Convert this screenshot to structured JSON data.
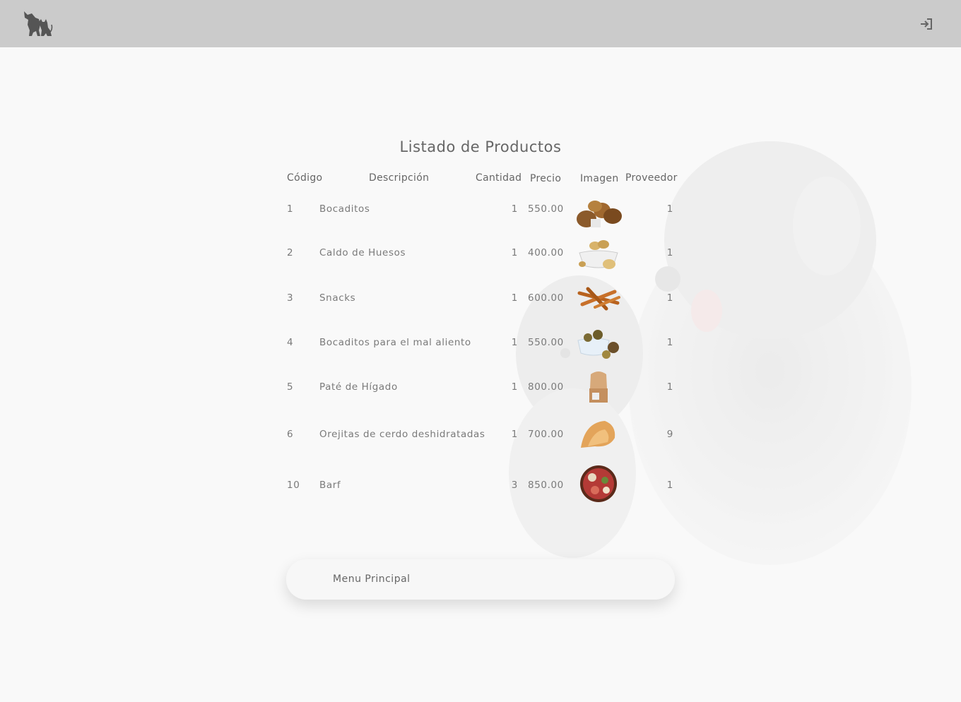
{
  "header": {
    "logo_icon": "dog-cat-silhouette-icon",
    "login_icon": "sign-in-icon"
  },
  "page": {
    "title": "Listado de Productos"
  },
  "table": {
    "columns": [
      "Código",
      "Descripción",
      "Cantidad",
      "Precio",
      "Imagen",
      "Proveedor"
    ],
    "rows": [
      {
        "codigo": "1",
        "descripcion": "Bocaditos",
        "cantidad": "1",
        "precio": "550.00",
        "imagen": "bocaditos-image",
        "proveedor": "1"
      },
      {
        "codigo": "2",
        "descripcion": "Caldo de Huesos",
        "cantidad": "1",
        "precio": "400.00",
        "imagen": "caldo-huesos-image",
        "proveedor": "1"
      },
      {
        "codigo": "3",
        "descripcion": "Snacks",
        "cantidad": "1",
        "precio": "600.00",
        "imagen": "snacks-image",
        "proveedor": "1"
      },
      {
        "codigo": "4",
        "descripcion": "Bocaditos para el mal aliento",
        "cantidad": "1",
        "precio": "550.00",
        "imagen": "bocaditos-aliento-image",
        "proveedor": "1"
      },
      {
        "codigo": "5",
        "descripcion": "Paté de Hígado",
        "cantidad": "1",
        "precio": "800.00",
        "imagen": "pate-higado-image",
        "proveedor": "1"
      },
      {
        "codigo": "6",
        "descripcion": "Orejitas de cerdo deshidratadas",
        "cantidad": "1",
        "precio": "700.00",
        "imagen": "orejitas-image",
        "proveedor": "9"
      },
      {
        "codigo": "10",
        "descripcion": "Barf",
        "cantidad": "3",
        "precio": "850.00",
        "imagen": "barf-image",
        "proveedor": "1"
      }
    ]
  },
  "footer": {
    "menu_label": "Menu Principal"
  },
  "colors": {
    "topbar": "#cbcbcb",
    "background": "#f9f9f9",
    "text": "#777777"
  }
}
